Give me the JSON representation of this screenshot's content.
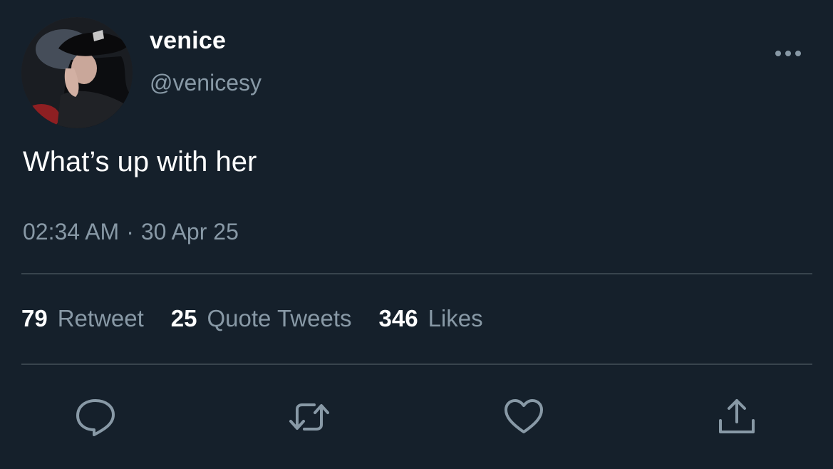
{
  "author": {
    "display_name": "venice",
    "handle": "@venicesy",
    "avatar_icon": "profile-photo"
  },
  "tweet": {
    "text": "What’s up with her",
    "time": "02:34 AM",
    "separator": "·",
    "date": "30 Apr 25"
  },
  "stats": {
    "retweets": {
      "count": "79",
      "label": "Retweet"
    },
    "quotes": {
      "count": "25",
      "label": "Quote Tweets"
    },
    "likes": {
      "count": "346",
      "label": "Likes"
    }
  },
  "actions": {
    "reply_icon": "speech-bubble-icon",
    "retweet_icon": "retweet-arrows-icon",
    "like_icon": "heart-outline-icon",
    "share_icon": "share-upload-icon",
    "more_icon": "ellipsis-icon"
  },
  "colors": {
    "background": "#15202b",
    "primary_text": "#ffffff",
    "secondary_text": "#8899a6",
    "divider": "#38444d"
  }
}
